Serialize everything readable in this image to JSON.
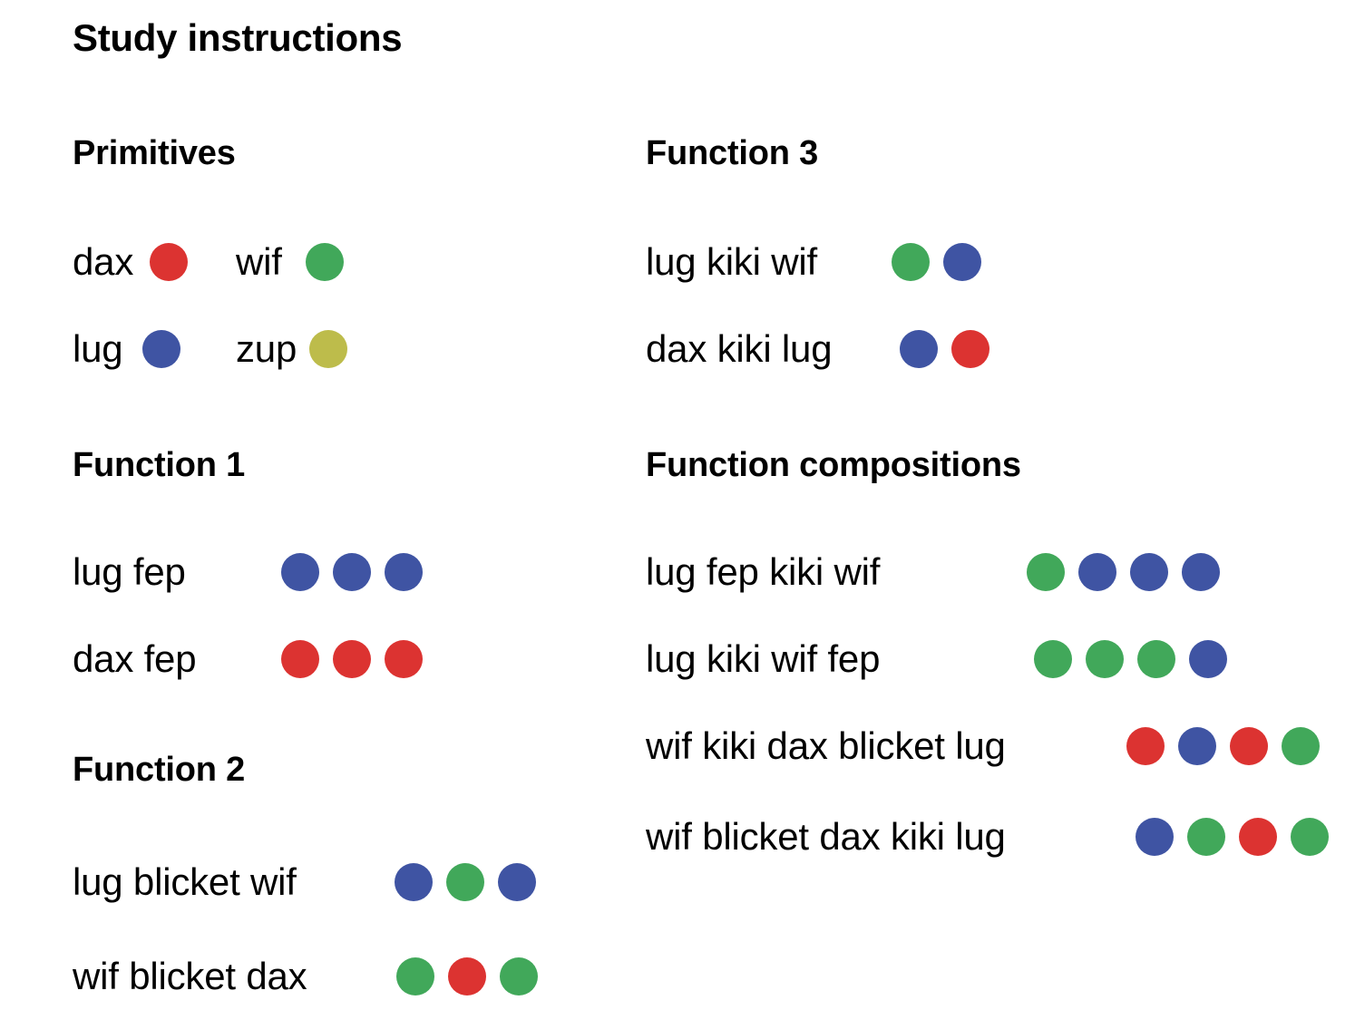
{
  "title": "Study instructions",
  "colors": {
    "red": "#DC3331",
    "green": "#41A85A",
    "blue": "#3F54A3",
    "yellow": "#BDBC4B",
    "text": "#000000",
    "background": "#FFFFFF"
  },
  "sections": {
    "primitives": {
      "heading": "Primitives",
      "items": [
        {
          "word": "dax",
          "color": "red"
        },
        {
          "word": "wif",
          "color": "green"
        },
        {
          "word": "lug",
          "color": "blue"
        },
        {
          "word": "zup",
          "color": "yellow"
        }
      ]
    },
    "function1": {
      "heading": "Function 1",
      "rows": [
        {
          "phrase": "lug fep",
          "output": [
            "blue",
            "blue",
            "blue"
          ]
        },
        {
          "phrase": "dax fep",
          "output": [
            "red",
            "red",
            "red"
          ]
        }
      ]
    },
    "function2": {
      "heading": "Function 2",
      "rows": [
        {
          "phrase": "lug blicket wif",
          "output": [
            "blue",
            "green",
            "blue"
          ]
        },
        {
          "phrase": "wif blicket dax",
          "output": [
            "green",
            "red",
            "green"
          ]
        }
      ]
    },
    "function3": {
      "heading": "Function 3",
      "rows": [
        {
          "phrase": "lug kiki wif",
          "output": [
            "green",
            "blue"
          ]
        },
        {
          "phrase": "dax kiki lug",
          "output": [
            "blue",
            "red"
          ]
        }
      ]
    },
    "compositions": {
      "heading": "Function compositions",
      "rows": [
        {
          "phrase": "lug fep kiki wif",
          "output": [
            "green",
            "blue",
            "blue",
            "blue"
          ]
        },
        {
          "phrase": "lug kiki wif fep",
          "output": [
            "green",
            "green",
            "green",
            "blue"
          ]
        },
        {
          "phrase": "wif kiki dax blicket lug",
          "output": [
            "red",
            "blue",
            "red",
            "green"
          ]
        },
        {
          "phrase": "wif blicket dax kiki lug",
          "output": [
            "blue",
            "green",
            "red",
            "green"
          ]
        }
      ]
    }
  }
}
